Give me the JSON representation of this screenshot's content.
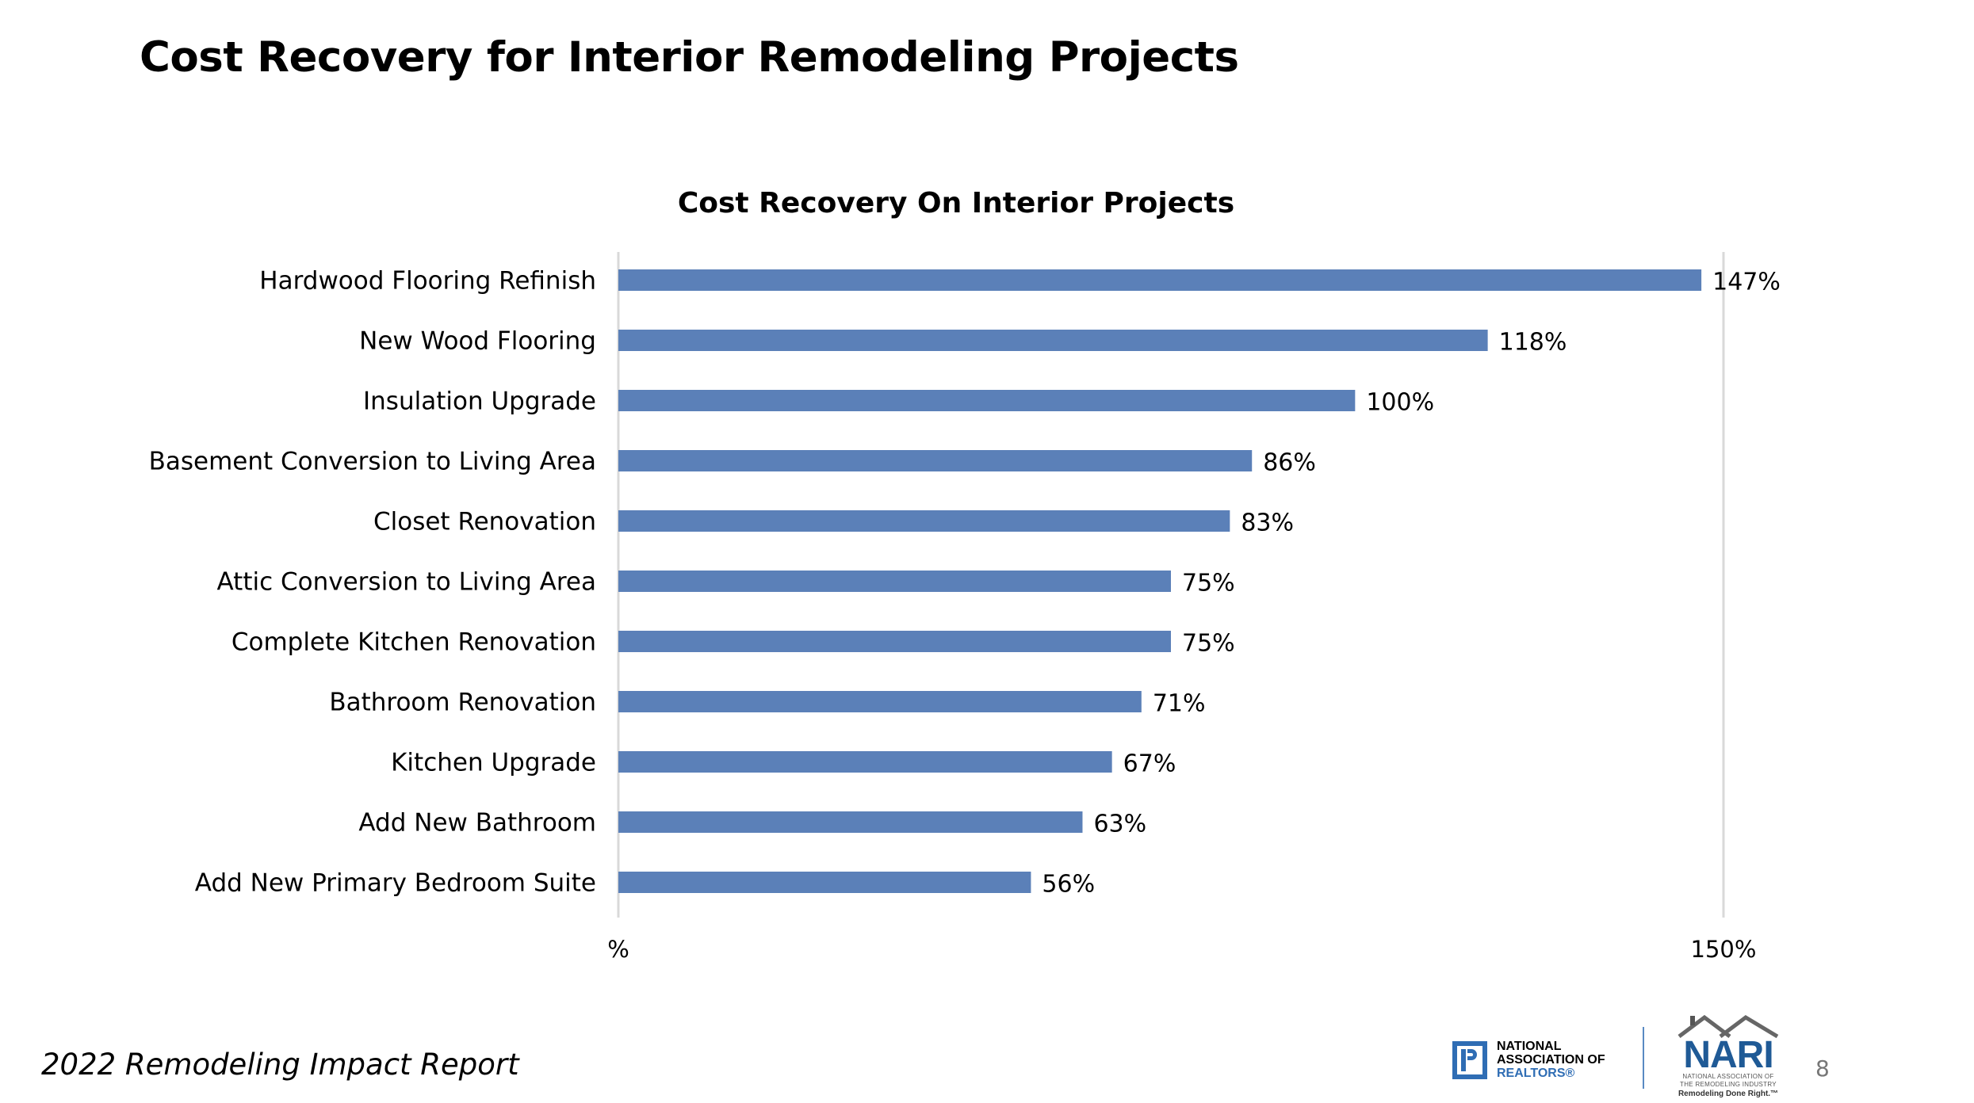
{
  "slide": {
    "title": "Cost Recovery for Interior Remodeling Projects",
    "footer_report": "2022 Remodeling Impact Report",
    "page_number": "8"
  },
  "logos": {
    "nar": {
      "line1": "NATIONAL",
      "line2": "ASSOCIATION OF",
      "line3": "REALTORS®"
    },
    "nari": {
      "word": "NARI",
      "sub1": "NATIONAL ASSOCIATION OF",
      "sub2": "THE REMODELING INDUSTRY",
      "tagline": "Remodeling Done Right.™"
    }
  },
  "colors": {
    "bar": "#5b80b8",
    "grid": "#d9d9d9",
    "text": "#000000"
  },
  "chart_data": {
    "type": "bar",
    "orientation": "horizontal",
    "title": "Cost Recovery On Interior Projects",
    "categories": [
      "Hardwood Flooring Refinish",
      "New Wood Flooring",
      "Insulation Upgrade",
      "Basement Conversion to Living Area",
      "Closet Renovation",
      "Attic Conversion to Living Area",
      "Complete Kitchen Renovation",
      "Bathroom Renovation",
      "Kitchen Upgrade",
      "Add New Bathroom",
      "Add New Primary Bedroom Suite"
    ],
    "values": [
      147,
      118,
      100,
      86,
      83,
      75,
      75,
      71,
      67,
      63,
      56
    ],
    "data_labels": [
      "147%",
      "118%",
      "100%",
      "86%",
      "83%",
      "75%",
      "75%",
      "71%",
      "67%",
      "63%",
      "56%"
    ],
    "xlim": [
      0,
      150
    ],
    "x_ticks": [
      0,
      150
    ],
    "x_tick_labels": [
      "%",
      "150%"
    ],
    "xlabel": "",
    "ylabel": "",
    "grid": true,
    "legend": "none"
  }
}
